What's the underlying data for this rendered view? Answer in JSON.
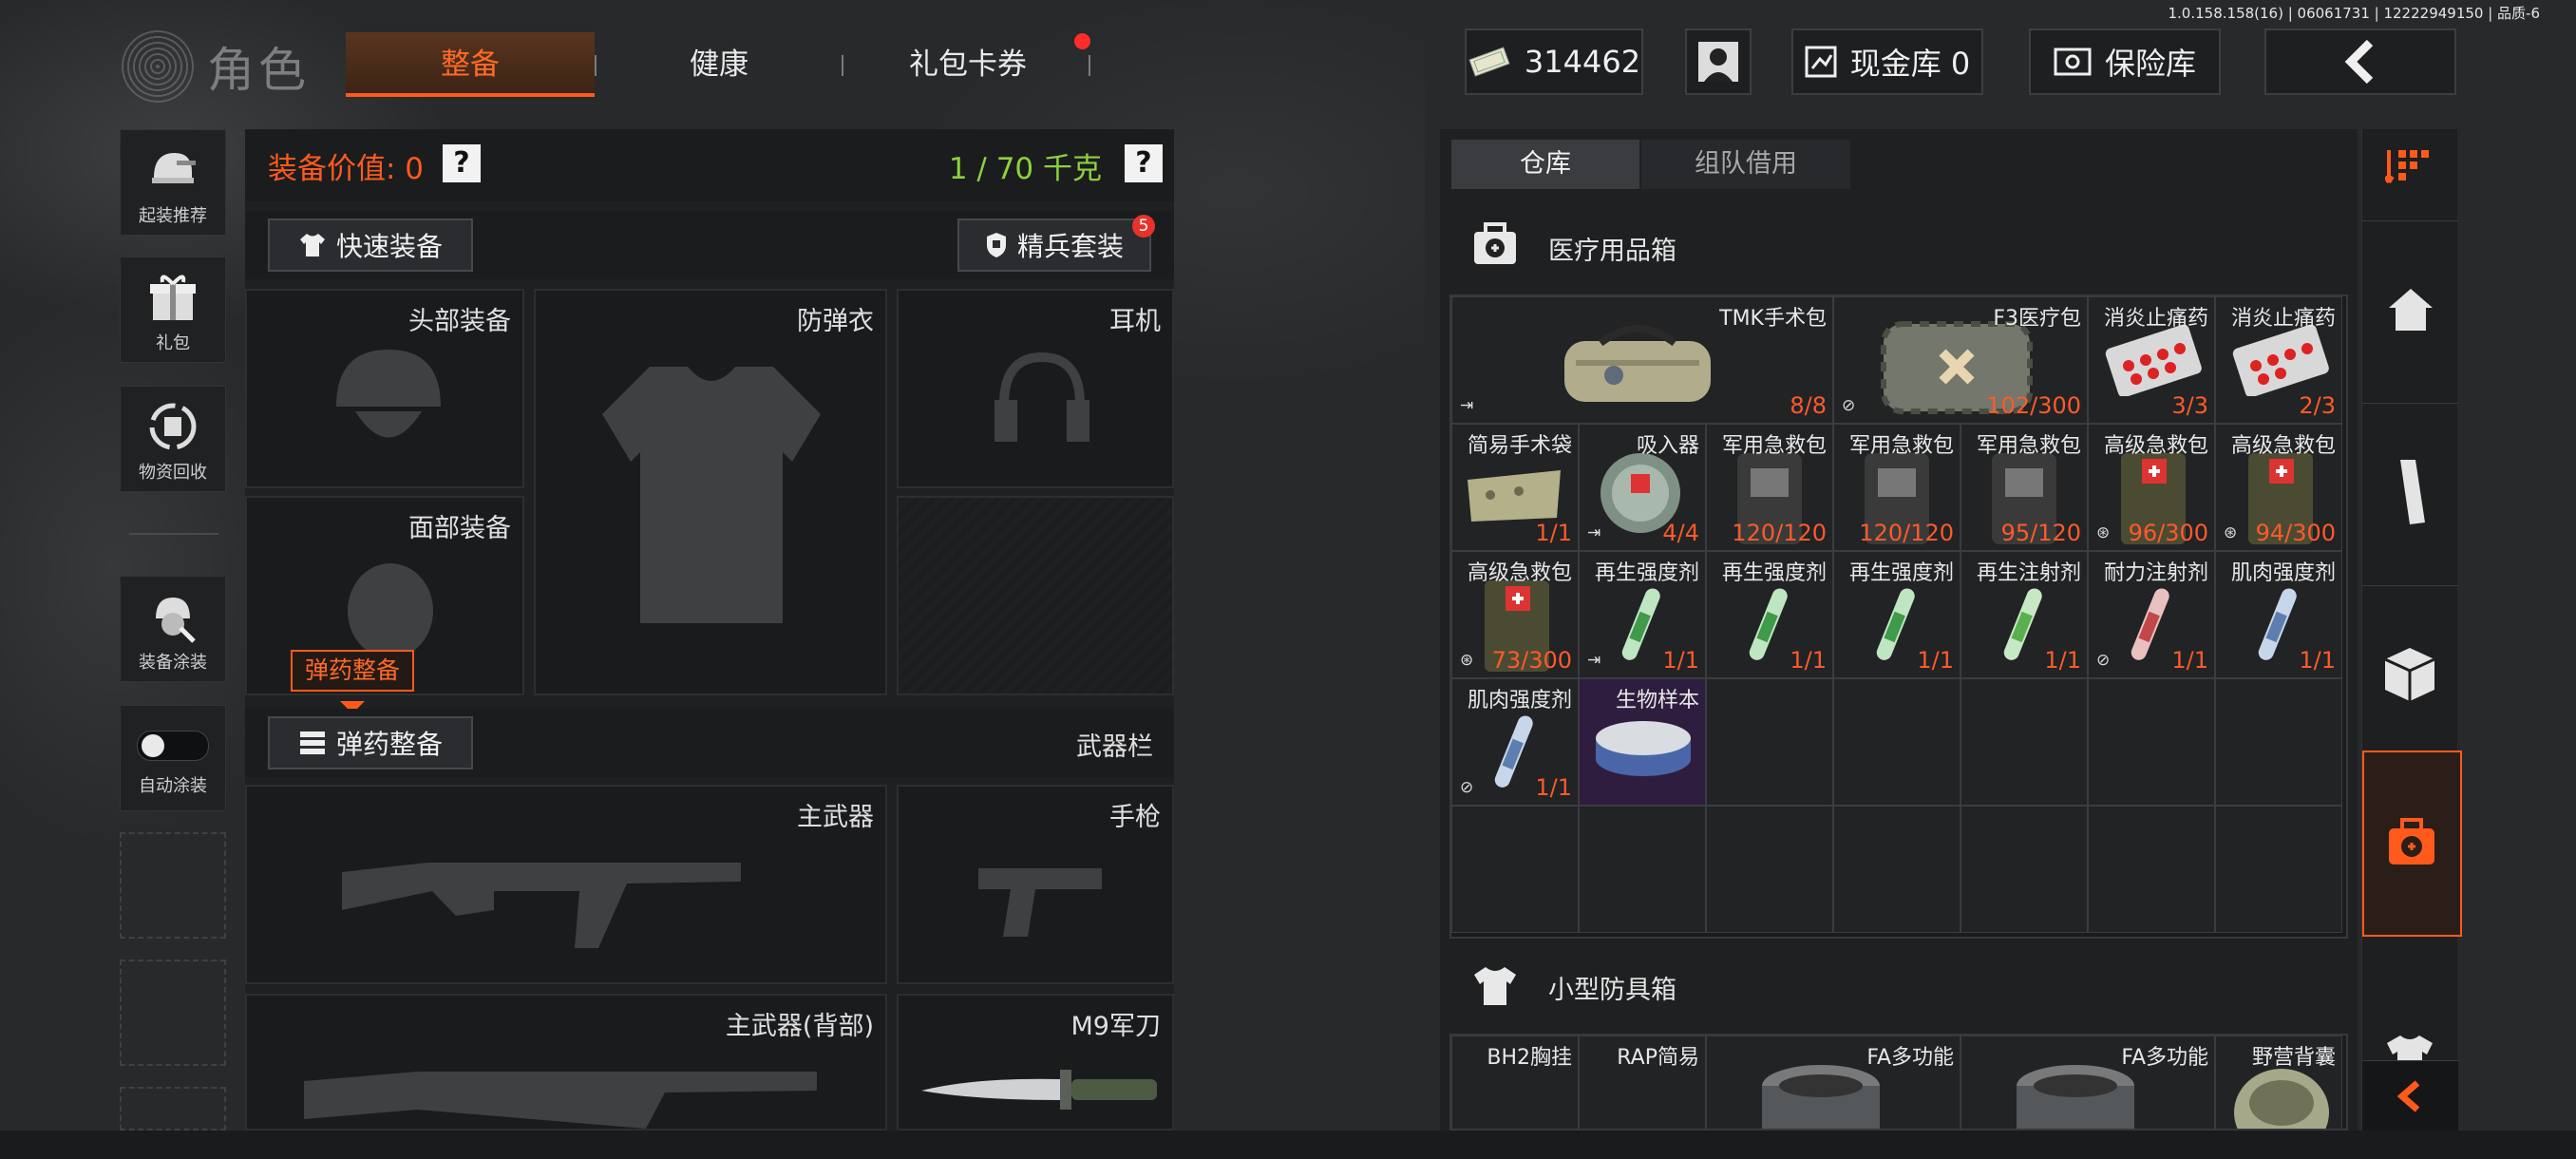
{
  "version": "1.0.158.158(16) | 06061731 | 12222949150 | 品质-6",
  "header": {
    "title": "角色",
    "tabs": [
      "整备",
      "健康",
      "礼包卡券"
    ],
    "currency": "314462",
    "cash_vault": "现金库 0",
    "safe_box": "保险库"
  },
  "left_menu": {
    "items": [
      "起装推荐",
      "礼包",
      "物资回收",
      "装备涂装",
      "自动涂装"
    ]
  },
  "equipment": {
    "value_label": "装备价值: 0",
    "weight_label": "1 / 70 千克",
    "help_mark": "?",
    "quick_equip": "快速装备",
    "elite_set": "精兵套装",
    "elite_badge": "5",
    "slots": {
      "head": "头部装备",
      "armor": "防弹衣",
      "headset": "耳机",
      "face": "面部装备",
      "primary": "主武器",
      "pistol": "手枪",
      "primary_back": "主武器(背部)",
      "knife": "M9军刀"
    },
    "ammo_tooltip": "弹药整备",
    "ammo_button": "弹药整备",
    "weapon_bar": "武器栏"
  },
  "inventory": {
    "tabs": [
      "仓库",
      "组队借用"
    ],
    "section1": "医疗用品箱",
    "section2": "小型防具箱",
    "medical_items": [
      {
        "name": "TMK手术包",
        "count": "8/8"
      },
      {
        "name": "F3医疗包",
        "count": "102/300"
      },
      {
        "name": "消炎止痛药",
        "count": "3/3"
      },
      {
        "name": "消炎止痛药",
        "count": "2/3"
      },
      {
        "name": "简易手术袋",
        "count": "1/1"
      },
      {
        "name": "吸入器",
        "count": "4/4"
      },
      {
        "name": "军用急救包",
        "count": "120/120"
      },
      {
        "name": "军用急救包",
        "count": "120/120"
      },
      {
        "name": "军用急救包",
        "count": "95/120"
      },
      {
        "name": "高级急救包",
        "count": "96/300"
      },
      {
        "name": "高级急救包",
        "count": "94/300"
      },
      {
        "name": "高级急救包",
        "count": "73/300"
      },
      {
        "name": "再生强度剂",
        "count": "1/1"
      },
      {
        "name": "再生强度剂",
        "count": "1/1"
      },
      {
        "name": "再生强度剂",
        "count": "1/1"
      },
      {
        "name": "再生注射剂",
        "count": "1/1"
      },
      {
        "name": "耐力注射剂",
        "count": "1/1"
      },
      {
        "name": "肌肉强度剂",
        "count": "1/1"
      },
      {
        "name": "肌肉强度剂",
        "count": "1/1"
      },
      {
        "name": "生物样本",
        "count": ""
      }
    ],
    "armor_items": [
      "BH2胸挂",
      "RAP简易",
      "FA多功能",
      "FA多功能",
      "野营背囊"
    ]
  },
  "colors": {
    "accent": "#ff5a1c",
    "count_red": "#ff5a2a",
    "weight_green": "#8ed13c"
  }
}
